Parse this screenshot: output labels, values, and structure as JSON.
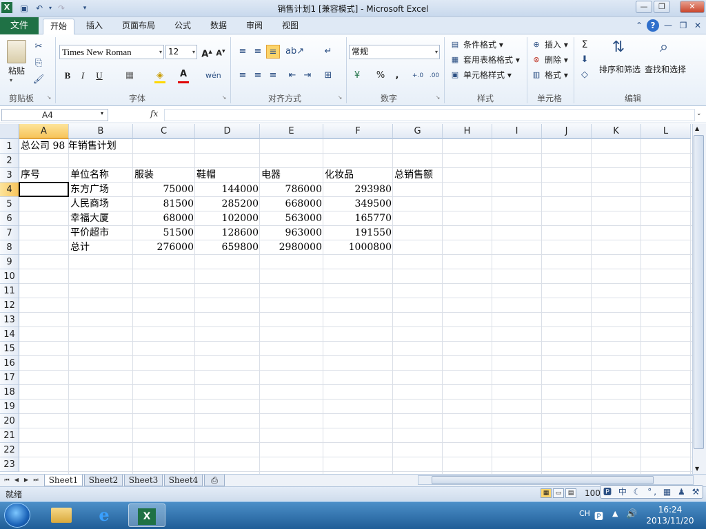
{
  "window": {
    "title": "销售计划1 [兼容模式] - Microsoft Excel",
    "app_icon": "X",
    "min": "—",
    "max": "❐",
    "close": "✕"
  },
  "ribbon_tabs": {
    "file": "文件",
    "tabs": [
      "开始",
      "插入",
      "页面布局",
      "公式",
      "数据",
      "审阅",
      "视图"
    ]
  },
  "clipboard": {
    "paste": "粘贴",
    "group_label": "剪贴板"
  },
  "font": {
    "name": "Times New Roman",
    "size": "12",
    "group_label": "字体"
  },
  "alignment": {
    "group_label": "对齐方式"
  },
  "number": {
    "format": "常规",
    "group_label": "数字",
    "percent": "%",
    "comma": ","
  },
  "styles": {
    "conditional": "条件格式",
    "table": "套用表格格式",
    "cell": "单元格样式",
    "group_label": "样式"
  },
  "cells": {
    "insert": "插入",
    "delete": "删除",
    "format": "格式",
    "group_label": "单元格"
  },
  "editing": {
    "sort": "排序和筛选",
    "find": "查找和选择",
    "group_label": "编辑"
  },
  "formula_bar": {
    "name_box": "A4",
    "fx": "fx",
    "value": ""
  },
  "grid": {
    "columns": [
      "A",
      "B",
      "C",
      "D",
      "E",
      "F",
      "G",
      "H",
      "I",
      "J",
      "K",
      "L"
    ],
    "rows": [
      "1",
      "2",
      "3",
      "4",
      "5",
      "6",
      "7",
      "8",
      "9",
      "10",
      "11",
      "12",
      "13",
      "14",
      "15",
      "16",
      "17",
      "18",
      "19",
      "20",
      "21",
      "22",
      "23"
    ],
    "selected_cell": "A4",
    "title": "总公司 98 年销售计划",
    "headers": [
      "序号",
      "单位名称",
      "服装",
      "鞋帽",
      "电器",
      "化妆品",
      "总销售额"
    ],
    "data": [
      [
        "",
        "东方广场",
        "75000",
        "144000",
        "786000",
        "293980",
        ""
      ],
      [
        "",
        "人民商场",
        "81500",
        "285200",
        "668000",
        "349500",
        ""
      ],
      [
        "",
        "幸福大厦",
        "68000",
        "102000",
        "563000",
        "165770",
        ""
      ],
      [
        "",
        "平价超市",
        "51500",
        "128600",
        "963000",
        "191550",
        ""
      ],
      [
        "",
        "总计",
        "276000",
        "659800",
        "2980000",
        "1000800",
        ""
      ]
    ]
  },
  "sheets": [
    "Sheet1",
    "Sheet2",
    "Sheet3",
    "Sheet4"
  ],
  "status": {
    "text": "就绪",
    "zoom": "100"
  },
  "ime": "中 ☾ °, ▦ ♟ ⚒",
  "taskbar": {
    "lang": "CH",
    "time": "16:24",
    "date": "2013/11/20"
  }
}
